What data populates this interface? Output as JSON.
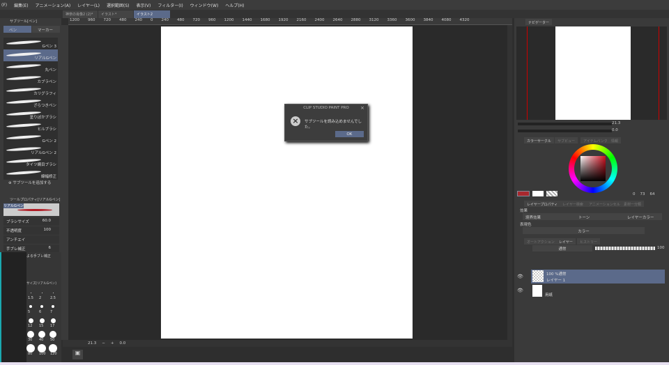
{
  "menu": [
    "(F)",
    "編集(E)",
    "アニメーション(A)",
    "レイヤー(L)",
    "選択範囲(S)",
    "表示(V)",
    "フィルター(I)",
    "ウィンドウ(W)",
    "ヘルプ(H)"
  ],
  "doc_tabs": [
    "神奈の肖像2 (2)*",
    "イラスト*",
    "イラスト2"
  ],
  "ruler": [
    "1200",
    "960",
    "720",
    "480",
    "240",
    "0",
    "240",
    "480",
    "720",
    "960",
    "1200",
    "1440",
    "1680",
    "1920",
    "2160",
    "2400",
    "2640",
    "2880",
    "3120",
    "3360",
    "3600",
    "3840",
    "4080",
    "4320"
  ],
  "subtool_panel": {
    "title": "サブツール[ペン]",
    "tabs": [
      "ペン",
      "マーカー"
    ],
    "brushes": [
      "Gペン 3",
      "リアルGペン",
      "丸ペン",
      "カブラペン",
      "カリグラフィ",
      "ざらつきペン",
      "塗りぼかブラシ",
      "ヒルブラシ",
      "Gペン 2",
      "リアルGペン 2",
      "タイツ網目ブラシ",
      "線幅修正"
    ],
    "selected": 1,
    "add_label": "サブツールを追加する"
  },
  "tool_property": {
    "title": "ツールプロパティ[リアルGペン]",
    "preview_label": "リアルGペン",
    "brush_size_label": "ブラシサイズ",
    "brush_size": "60.0",
    "opacity_label": "不透明度",
    "opacity": "100",
    "antialias_label": "アンチエイ",
    "stabilization_label": "手ブレ補正",
    "stabilization": "6",
    "speed_stab_label": "よる手ブレ補正"
  },
  "brush_size_panel": {
    "title": "サイズ[リアルGペン]",
    "sizes": [
      "1.5",
      "2",
      "2.5",
      "5",
      "6",
      "7",
      "12",
      "15",
      "17",
      "30",
      "40",
      "50",
      "80",
      "100",
      "120"
    ]
  },
  "bottom_bar": {
    "zoom": "21.3",
    "angle": "0.0"
  },
  "dialog": {
    "title": "CLIP STUDIO PAINT PRO",
    "message": "サブツールを読み込めませんでした。",
    "ok": "OK",
    "icon": "error-x-icon"
  },
  "navigator": {
    "tab": "ナビゲーター",
    "zoom": "21.3",
    "angle": "0.0"
  },
  "color_tabs": [
    "カラーサークル",
    "サブビュー",
    "アイテムバンク",
    "情報"
  ],
  "color": {
    "main": "#a8282e",
    "sub": "#ffffff",
    "values": [
      "0",
      "73",
      "64"
    ]
  },
  "layer_property": {
    "tabs": [
      "レイヤープロパティ",
      "レイヤー検索",
      "アニメーションセル",
      "素材ー分類"
    ],
    "effect_label": "効果",
    "effects": [
      "境界効果",
      "トーン",
      "レイヤーカラー"
    ],
    "expression_label": "表現色",
    "expression": "カラー"
  },
  "layer_panel": {
    "tabs": [
      "オートアクション",
      "レイヤー",
      "ヒストリー"
    ],
    "blend": "通常",
    "opacity": "100",
    "layers": [
      {
        "info": "100 %通常",
        "name": "レイヤー 1"
      },
      {
        "info": "",
        "name": "用紙"
      }
    ]
  }
}
